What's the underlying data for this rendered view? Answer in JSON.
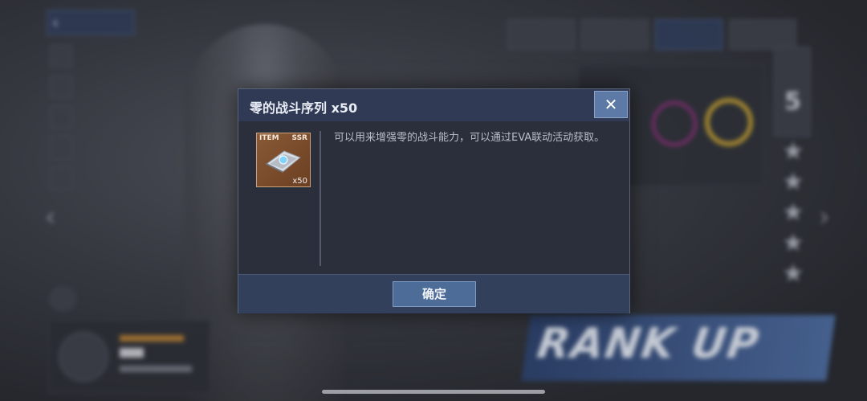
{
  "background": {
    "rank_up_text": "RANK UP",
    "rank_number": "5"
  },
  "dialog": {
    "title": "零的战斗序列 x50",
    "close_symbol": "✕",
    "item": {
      "type_label": "ITEM",
      "rarity_label": "SSR",
      "quantity_label": "x50",
      "icon": "combat-sequence-item-icon"
    },
    "description": "可以用来增强零的战斗能力，可以通过EVA联动活动获取。",
    "confirm_label": "确定"
  },
  "colors": {
    "dialog_header": "#303a55",
    "confirm_button": "#4d6c98",
    "close_button": "#5d7aa6",
    "item_frame": "#8a5a36",
    "rank_up_banner": "#3a5688"
  }
}
